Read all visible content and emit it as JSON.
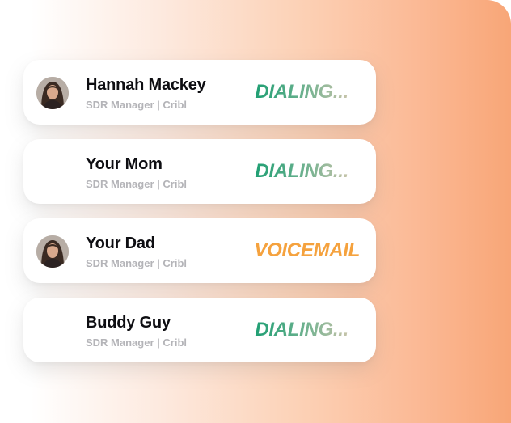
{
  "colors": {
    "dialing_start": "#1f9f73",
    "dialing_end": "#c7c4aa",
    "voicemail": "#f5a23e",
    "background_accent": "#f8a677"
  },
  "contacts": [
    {
      "name": "Hannah Mackey",
      "subtitle": "SDR Manager | Cribl",
      "status": "DIALING...",
      "has_avatar": true
    },
    {
      "name": "Your Mom",
      "subtitle": "SDR Manager | Cribl",
      "status": "DIALING...",
      "has_avatar": false
    },
    {
      "name": "Your Dad",
      "subtitle": "SDR Manager | Cribl",
      "status": "VOICEMAIL",
      "has_avatar": true
    },
    {
      "name": "Buddy Guy",
      "subtitle": "SDR Manager | Cribl",
      "status": "DIALING...",
      "has_avatar": false
    }
  ]
}
